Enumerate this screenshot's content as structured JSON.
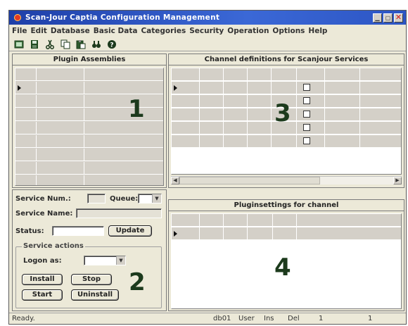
{
  "window": {
    "title": "Scan-Jour Captia Configuration Management",
    "controls": [
      "minimize",
      "maximize",
      "close"
    ]
  },
  "menu": [
    "File",
    "Edit",
    "Database",
    "Basic Data",
    "Categories",
    "Security",
    "Operation",
    "Options",
    "Help"
  ],
  "toolbar": [
    {
      "icon": "screen-icon"
    },
    {
      "icon": "save-icon"
    },
    {
      "icon": "cut-icon"
    },
    {
      "icon": "copy-icon"
    },
    {
      "icon": "paste-icon"
    },
    {
      "icon": "find-icon"
    },
    {
      "icon": "help-icon"
    }
  ],
  "panels": {
    "plugin_assemblies": {
      "title": "Plugin Assemblies",
      "number": "1"
    },
    "channel_definitions": {
      "title": "Channel definitions for Scanjour Services",
      "number": "3"
    },
    "service_details": {
      "number": "2",
      "service_num_label": "Service Num.:",
      "queue_label": "Queue:",
      "service_name_label": "Service Name:",
      "status_label": "Status:",
      "update_label": "Update",
      "actions_title": "Service actions",
      "logon_as_label": "Logon as:",
      "install_label": "Install",
      "stop_label": "Stop",
      "start_label": "Start",
      "uninstall_label": "Uninstall"
    },
    "plugin_settings": {
      "title": "Pluginsettings for channel",
      "number": "4"
    }
  },
  "status": {
    "text": "Ready.",
    "db": "db01",
    "user": "User",
    "ins": "Ins",
    "del": "Del",
    "val1": "1",
    "val2": "1"
  }
}
